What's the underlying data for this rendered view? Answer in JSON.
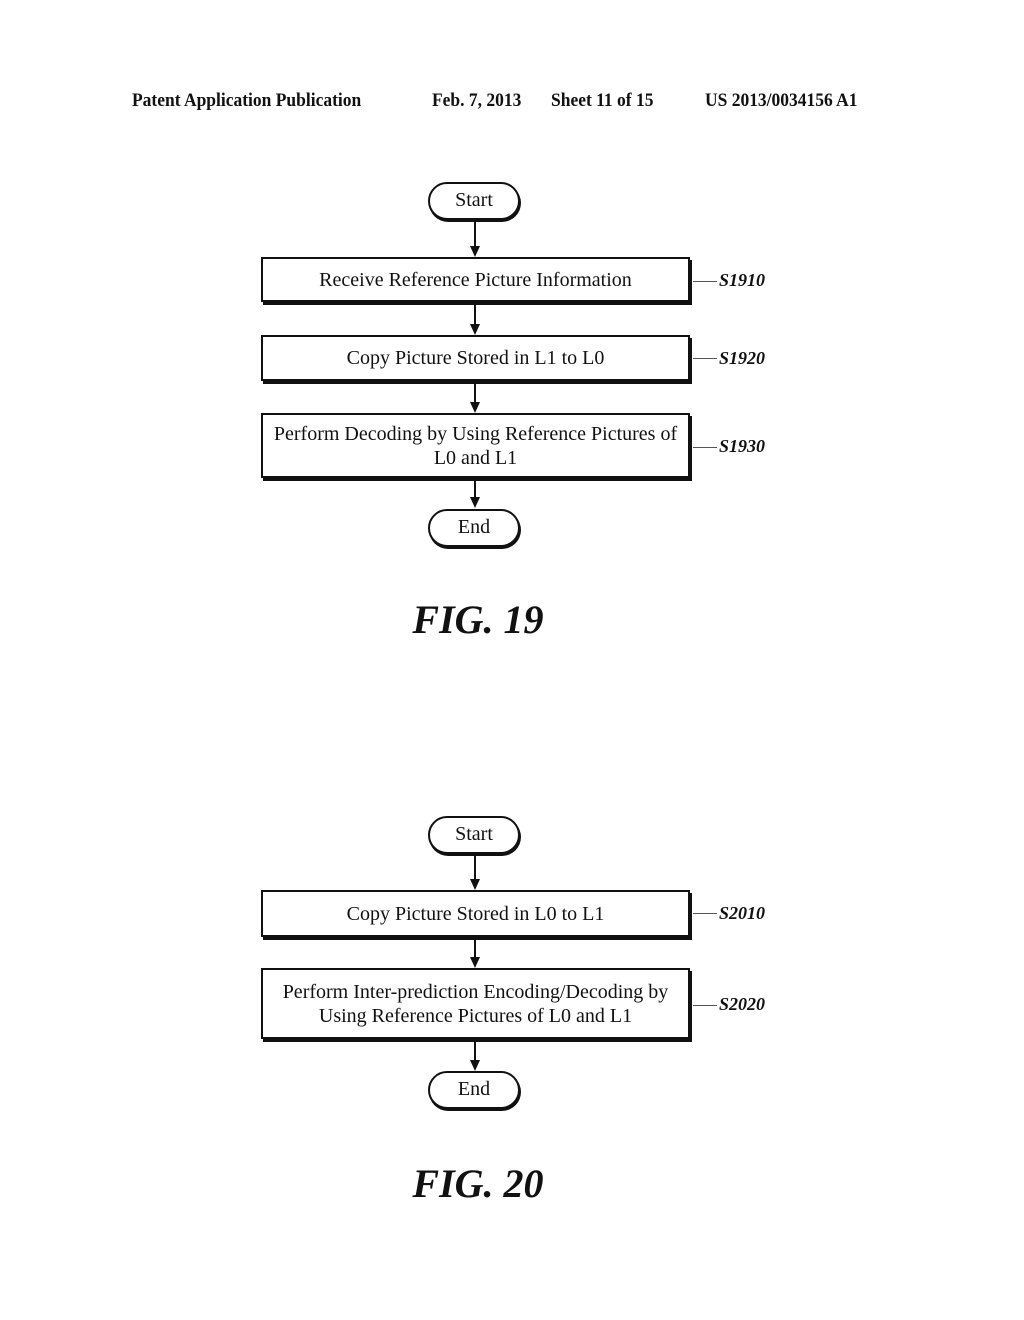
{
  "header": {
    "publication": "Patent Application Publication",
    "date": "Feb. 7, 2013",
    "sheet": "Sheet 11 of 15",
    "number": "US 2013/0034156 A1"
  },
  "fig19": {
    "start": "Start",
    "steps": [
      {
        "text": "Receive Reference Picture Information",
        "label": "S1910"
      },
      {
        "text": "Copy Picture Stored in L1 to L0",
        "label": "S1920"
      },
      {
        "text": "Perform Decoding by Using Reference Pictures of L0 and L1",
        "label": "S1930"
      }
    ],
    "end": "End",
    "caption": "FIG. 19"
  },
  "fig20": {
    "start": "Start",
    "steps": [
      {
        "text": "Copy Picture Stored in L0 to L1",
        "label": "S2010"
      },
      {
        "text": "Perform Inter-prediction Encoding/Decoding by Using Reference Pictures of L0 and L1",
        "label": "S2020"
      }
    ],
    "end": "End",
    "caption": "FIG. 20"
  }
}
